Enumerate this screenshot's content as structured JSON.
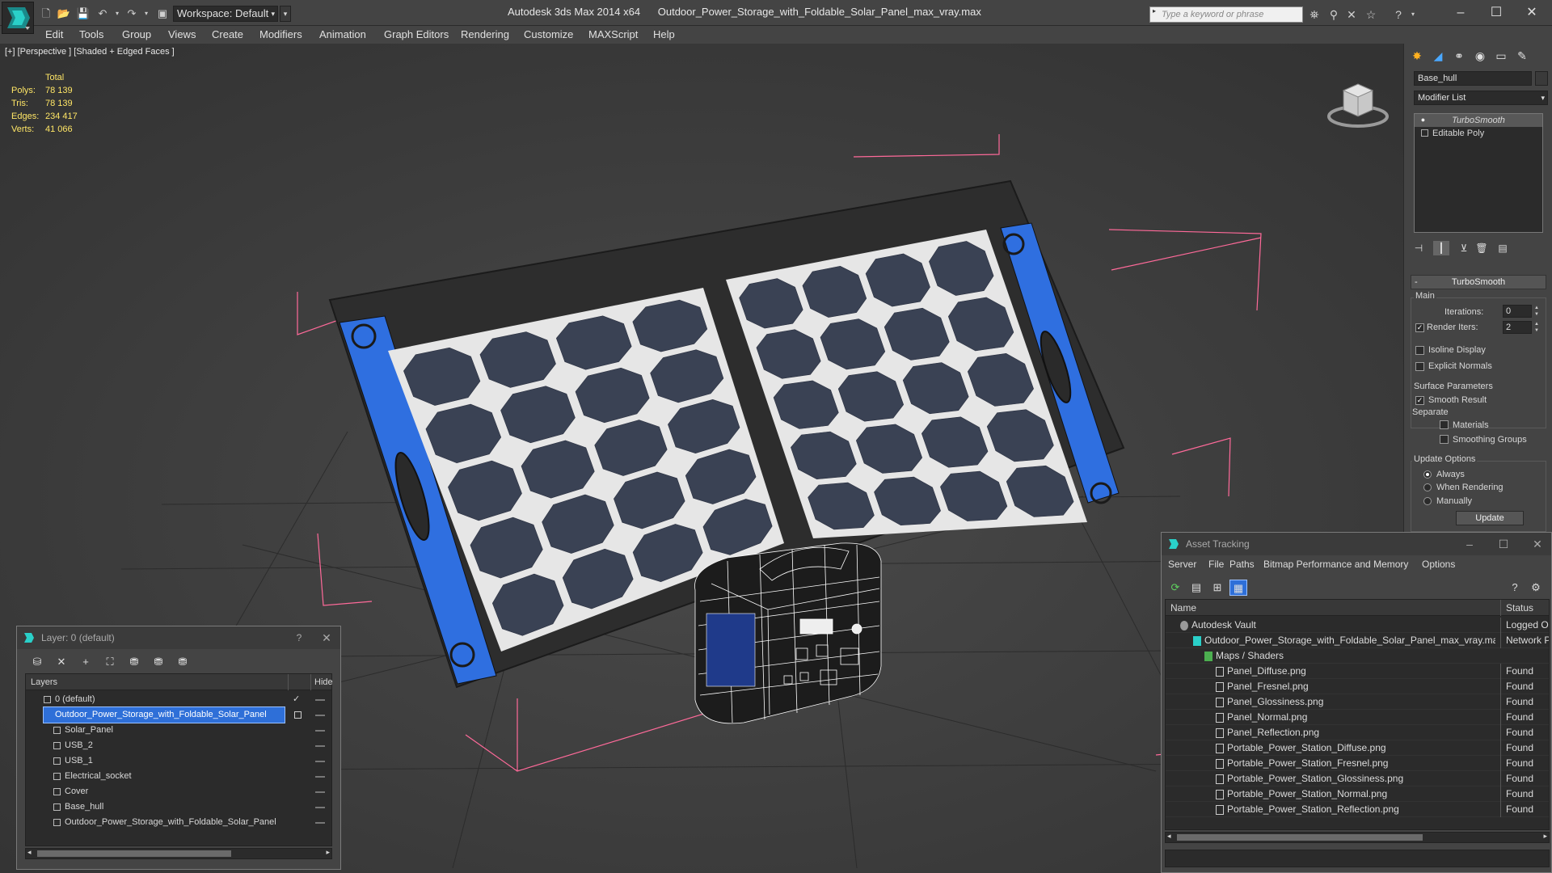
{
  "app": {
    "title": "Autodesk 3ds Max  2014 x64",
    "filename": "Outdoor_Power_Storage_with_Foldable_Solar_Panel_max_vray.max",
    "workspace": "Workspace: Default",
    "search_placeholder": "Type a keyword or phrase"
  },
  "menu": [
    "Edit",
    "Tools",
    "Group",
    "Views",
    "Create",
    "Modifiers",
    "Animation",
    "Graph Editors",
    "Rendering",
    "Customize",
    "MAXScript",
    "Help"
  ],
  "viewport": {
    "label": "[+] [Perspective ] [Shaded + Edged Faces ]",
    "stats": {
      "total": "Total",
      "polys_label": "Polys:",
      "polys": "78 139",
      "tris_label": "Tris:",
      "tris": "78 139",
      "edges_label": "Edges:",
      "edges": "234 417",
      "verts_label": "Verts:",
      "verts": "41 066"
    },
    "colors": {
      "panel_frame": "#2d2d2d",
      "cell": "#3a4254",
      "cell_bg": "#e6e6e6",
      "side_blue": "#2f6fe0",
      "bbox_pink": "#ff6a9a"
    }
  },
  "command_panel": {
    "object_name": "Base_hull",
    "modifier_list": "Modifier List",
    "stack": [
      "TurboSmooth",
      "Editable Poly"
    ],
    "rollout": "TurboSmooth",
    "main_group": "Main",
    "iterations_label": "Iterations:",
    "iterations": "0",
    "render_iters_label": "Render Iters:",
    "render_iters": "2",
    "isoline": "Isoline Display",
    "explicit": "Explicit Normals",
    "surface_group": "Surface Parameters",
    "smooth_result": "Smooth Result",
    "separate": "Separate",
    "materials": "Materials",
    "smoothing_groups": "Smoothing Groups",
    "update_group": "Update Options",
    "always": "Always",
    "when_rendering": "When Rendering",
    "manually": "Manually",
    "update_btn": "Update"
  },
  "layer_dialog": {
    "title": "Layer: 0 (default)",
    "help": "?",
    "col_layers": "Layers",
    "col_hide": "Hide",
    "rows": [
      {
        "name": "0 (default)",
        "level": 0
      },
      {
        "name": "Outdoor_Power_Storage_with_Foldable_Solar_Panel",
        "level": 0
      },
      {
        "name": "Solar_Panel",
        "level": 1
      },
      {
        "name": "USB_2",
        "level": 1
      },
      {
        "name": "USB_1",
        "level": 1
      },
      {
        "name": "Electrical_socket",
        "level": 1
      },
      {
        "name": "Cover",
        "level": 1
      },
      {
        "name": "Base_hull",
        "level": 1
      },
      {
        "name": "Outdoor_Power_Storage_with_Foldable_Solar_Panel",
        "level": 1
      }
    ]
  },
  "asset_dialog": {
    "title": "Asset Tracking",
    "menu": [
      "Server",
      "File",
      "Paths",
      "Bitmap Performance and Memory",
      "Options"
    ],
    "col_name": "Name",
    "col_status": "Status",
    "rows": [
      {
        "name": "Autodesk Vault",
        "status": "Logged Ou",
        "level": 0
      },
      {
        "name": "Outdoor_Power_Storage_with_Foldable_Solar_Panel_max_vray.max",
        "status": "Network P",
        "level": 1
      },
      {
        "name": "Maps / Shaders",
        "status": "",
        "level": 2
      },
      {
        "name": "Panel_Diffuse.png",
        "status": "Found",
        "level": 3
      },
      {
        "name": "Panel_Fresnel.png",
        "status": "Found",
        "level": 3
      },
      {
        "name": "Panel_Glossiness.png",
        "status": "Found",
        "level": 3
      },
      {
        "name": "Panel_Normal.png",
        "status": "Found",
        "level": 3
      },
      {
        "name": "Panel_Reflection.png",
        "status": "Found",
        "level": 3
      },
      {
        "name": "Portable_Power_Station_Diffuse.png",
        "status": "Found",
        "level": 3
      },
      {
        "name": "Portable_Power_Station_Fresnel.png",
        "status": "Found",
        "level": 3
      },
      {
        "name": "Portable_Power_Station_Glossiness.png",
        "status": "Found",
        "level": 3
      },
      {
        "name": "Portable_Power_Station_Normal.png",
        "status": "Found",
        "level": 3
      },
      {
        "name": "Portable_Power_Station_Reflection.png",
        "status": "Found",
        "level": 3
      }
    ]
  }
}
